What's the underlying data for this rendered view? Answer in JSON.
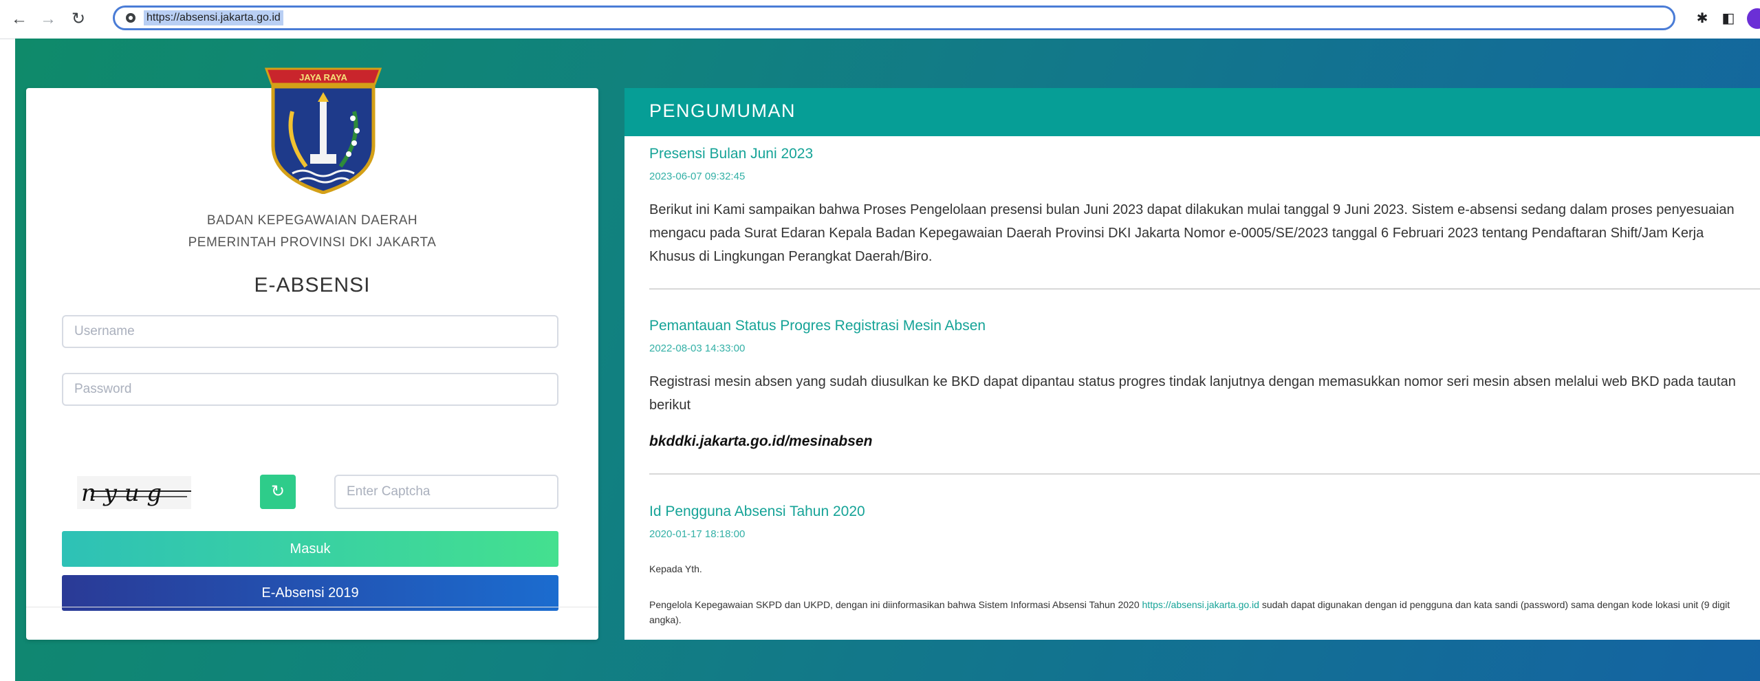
{
  "browser": {
    "url": "https://absensi.jakarta.go.id"
  },
  "logo": {
    "banner_text": "JAYA RAYA"
  },
  "login": {
    "org_line1": "BADAN KEPEGAWAIAN DAERAH",
    "org_line2": "PEMERINTAH PROVINSI DKI JAKARTA",
    "app_title": "E-ABSENSI",
    "username_placeholder": "Username",
    "password_placeholder": "Password",
    "captcha_text": "n y u g",
    "captcha_placeholder": "Enter Captcha",
    "masuk_label": "Masuk",
    "absensi2019_label": "E-Absensi 2019"
  },
  "announcements": {
    "header": "PENGUMUMAN",
    "items": [
      {
        "title": "Presensi Bulan Juni 2023",
        "date": "2023-06-07 09:32:45",
        "body": "Berikut ini Kami sampaikan bahwa Proses Pengelolaan presensi bulan Juni 2023 dapat dilakukan mulai tanggal 9 Juni 2023. Sistem e-absensi sedang dalam proses penyesuaian mengacu pada Surat Edaran Kepala Badan Kepegawaian Daerah Provinsi DKI Jakarta Nomor e-0005/SE/2023 tanggal 6 Februari 2023 tentang Pendaftaran Shift/Jam Kerja Khusus di Lingkungan Perangkat Daerah/Biro."
      },
      {
        "title": "Pemantauan Status Progres Registrasi Mesin Absen",
        "date": "2022-08-03 14:33:00",
        "body": "Registrasi mesin absen yang sudah diusulkan ke BKD dapat dipantau status progres tindak lanjutnya dengan memasukkan nomor seri mesin absen melalui web BKD pada tautan berikut",
        "link": "bkddki.jakarta.go.id/mesinabsen"
      },
      {
        "title": "Id Pengguna Absensi Tahun 2020",
        "date": "2020-01-17 18:18:00",
        "greeting": "Kepada Yth.",
        "body_before": "Pengelola Kepegawaian SKPD dan UKPD, dengan ini diinformasikan bahwa Sistem Informasi Absensi Tahun 2020 ",
        "body_link": "https://absensi.jakarta.go.id",
        "body_after": " sudah dapat digunakan dengan id pengguna dan kata sandi (password) sama dengan kode lokasi unit (9 digit angka)."
      }
    ]
  },
  "colors": {
    "accent_teal": "#069e96",
    "link_teal": "#15a397",
    "masuk_gradient": [
      "#2ec1b6",
      "#44e08f"
    ],
    "absensi2019_gradient": [
      "#2a3a96",
      "#1b6ccf"
    ]
  },
  "icons": [
    "back-arrow-icon",
    "forward-arrow-icon",
    "reload-icon",
    "site-info-icon",
    "extensions-icon",
    "side-panel-icon",
    "profile-icon",
    "refresh-captcha-icon"
  ]
}
